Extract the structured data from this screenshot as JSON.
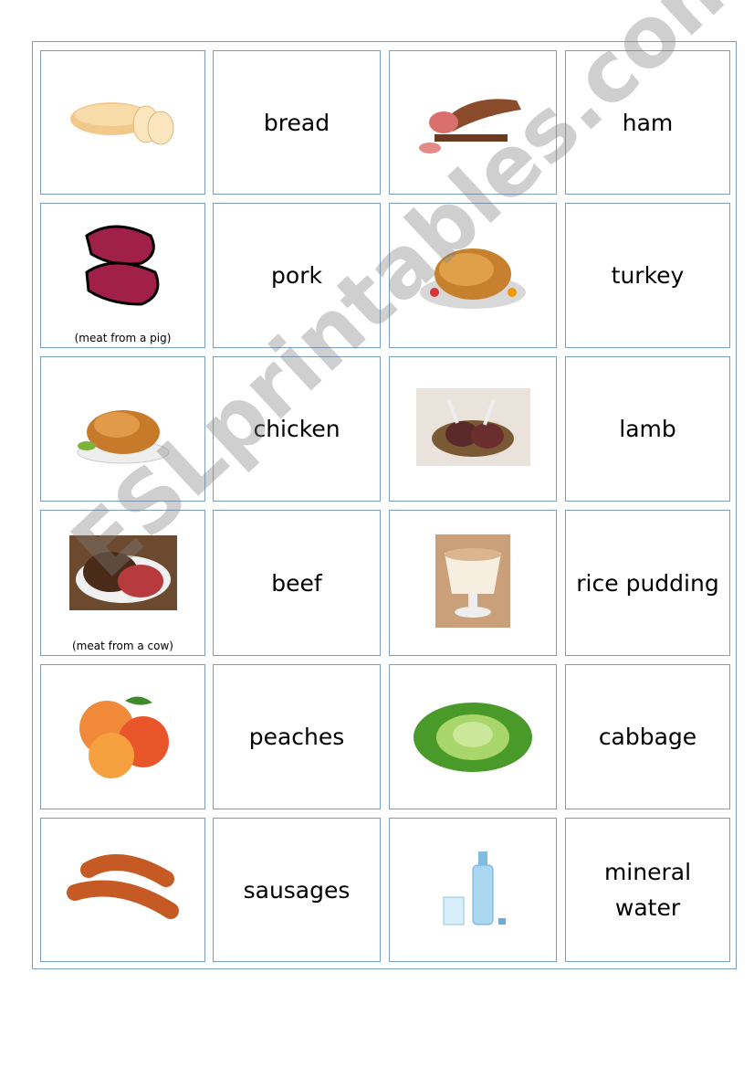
{
  "cards": [
    {
      "type": "image",
      "icon": "bread-icon"
    },
    {
      "type": "word",
      "text": "bread"
    },
    {
      "type": "image",
      "icon": "ham-icon"
    },
    {
      "type": "word",
      "text": "ham"
    },
    {
      "type": "image",
      "icon": "pork-icon",
      "caption": "(meat from a pig)"
    },
    {
      "type": "word",
      "text": "pork"
    },
    {
      "type": "image",
      "icon": "turkey-icon"
    },
    {
      "type": "word",
      "text": "turkey"
    },
    {
      "type": "image",
      "icon": "chicken-icon"
    },
    {
      "type": "word",
      "text": "chicken"
    },
    {
      "type": "image",
      "icon": "lamb-icon"
    },
    {
      "type": "word",
      "text": "lamb"
    },
    {
      "type": "image",
      "icon": "beef-icon",
      "caption": "(meat from a cow)"
    },
    {
      "type": "word",
      "text": "beef"
    },
    {
      "type": "image",
      "icon": "rice-pudding-icon"
    },
    {
      "type": "word",
      "text": "rice pudding"
    },
    {
      "type": "image",
      "icon": "peaches-icon"
    },
    {
      "type": "word",
      "text": "peaches"
    },
    {
      "type": "image",
      "icon": "cabbage-icon"
    },
    {
      "type": "word",
      "text": "cabbage"
    },
    {
      "type": "image",
      "icon": "sausages-icon"
    },
    {
      "type": "word",
      "text": "sausages"
    },
    {
      "type": "image",
      "icon": "mineral-water-icon"
    },
    {
      "type": "word",
      "text": "mineral water"
    }
  ],
  "watermark": "ESLprintables.com",
  "colors": {
    "border": "#7a9cbd"
  }
}
